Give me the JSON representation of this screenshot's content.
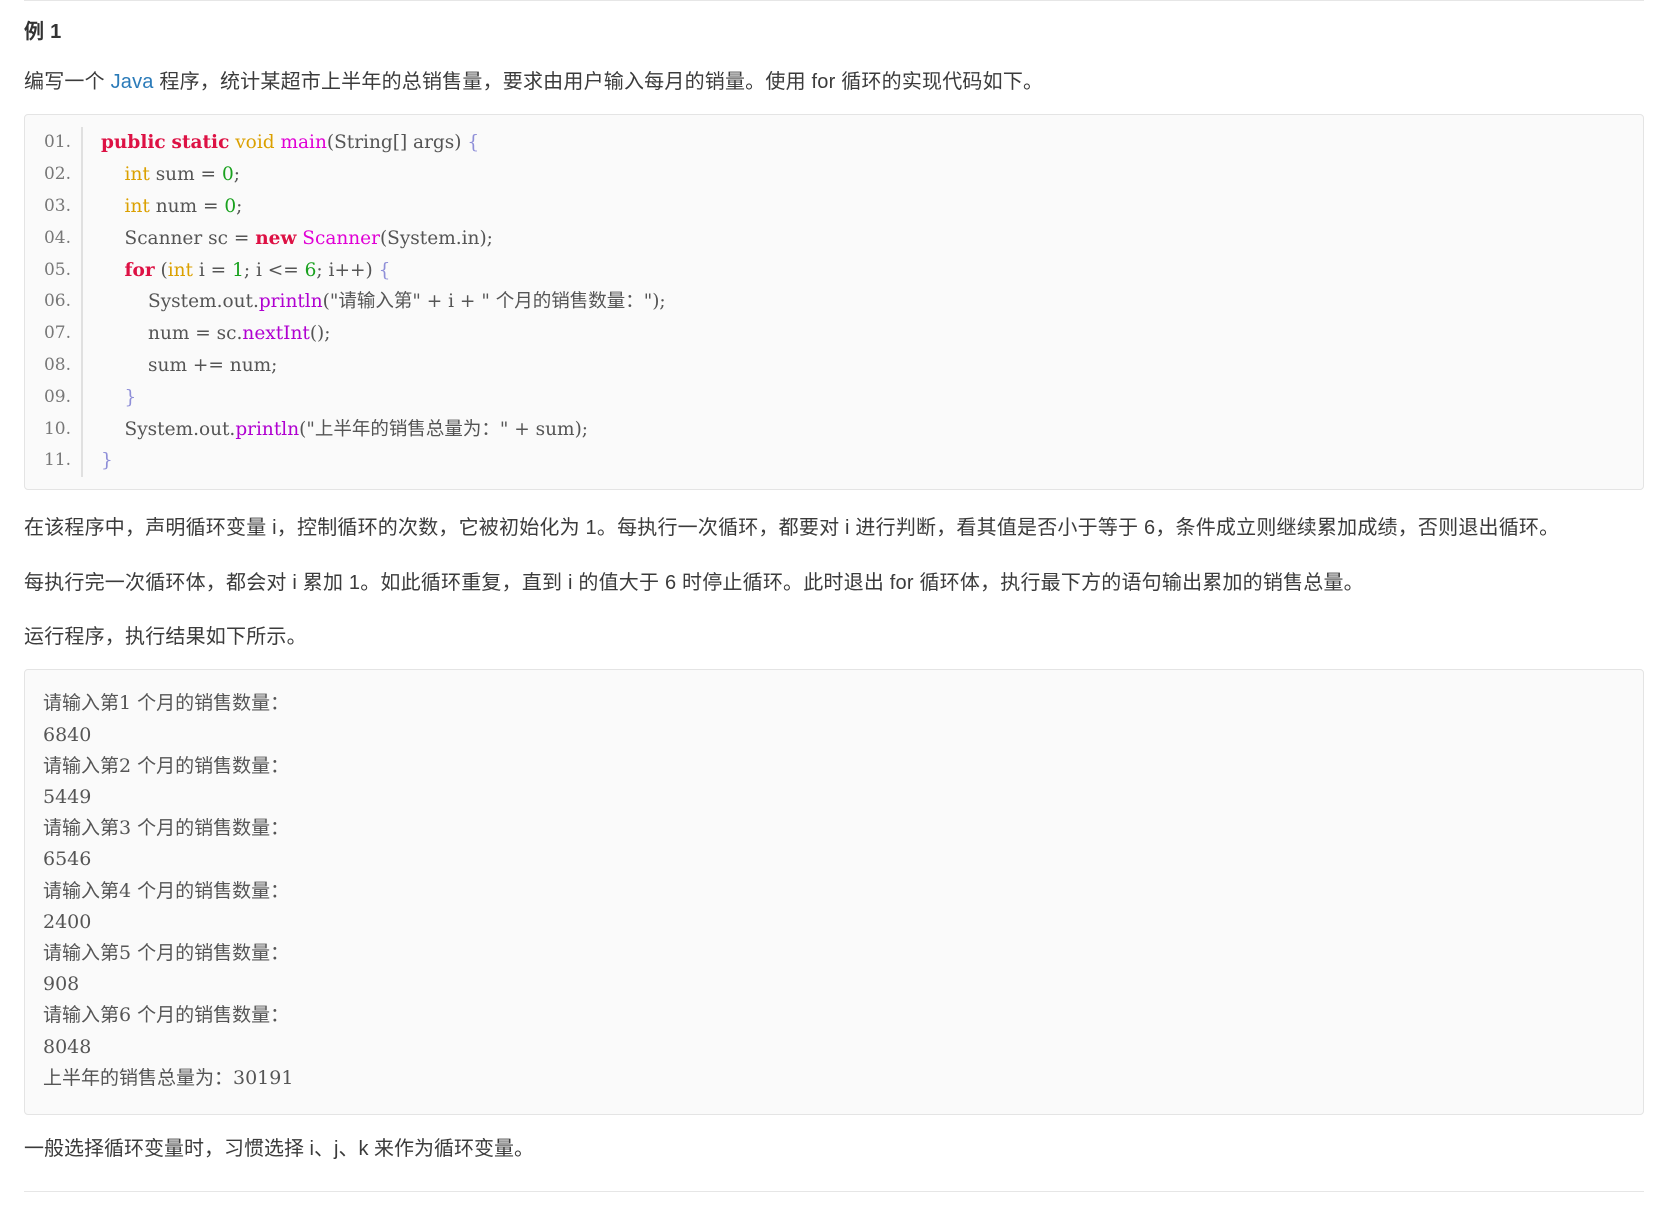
{
  "heading": "例 1",
  "intro": {
    "before_link": "编写一个 ",
    "link": "Java",
    "after_link": " 程序，统计某超市上半年的总销售量，要求由用户输入每月的销量。使用 for 循环的实现代码如下。"
  },
  "code_block": {
    "language": "java",
    "lines": [
      {
        "num": "01.",
        "tokens": [
          {
            "t": "public",
            "c": "k-red"
          },
          {
            "t": " ",
            "c": "k-plain"
          },
          {
            "t": "static",
            "c": "k-red"
          },
          {
            "t": " ",
            "c": "k-plain"
          },
          {
            "t": "void",
            "c": "k-orange"
          },
          {
            "t": " ",
            "c": "k-plain"
          },
          {
            "t": "main",
            "c": "k-pink"
          },
          {
            "t": "(String[] args)",
            "c": "k-plain"
          },
          {
            "t": " ",
            "c": "k-plain"
          },
          {
            "t": "{",
            "c": "k-brace"
          }
        ]
      },
      {
        "num": "02.",
        "tokens": [
          {
            "t": "    ",
            "c": "k-plain"
          },
          {
            "t": "int",
            "c": "k-orange"
          },
          {
            "t": " sum ",
            "c": "k-plain"
          },
          {
            "t": "=",
            "c": "k-plain"
          },
          {
            "t": " ",
            "c": "k-plain"
          },
          {
            "t": "0",
            "c": "k-green"
          },
          {
            "t": ";",
            "c": "k-plain"
          }
        ]
      },
      {
        "num": "03.",
        "tokens": [
          {
            "t": "    ",
            "c": "k-plain"
          },
          {
            "t": "int",
            "c": "k-orange"
          },
          {
            "t": " num ",
            "c": "k-plain"
          },
          {
            "t": "=",
            "c": "k-plain"
          },
          {
            "t": " ",
            "c": "k-plain"
          },
          {
            "t": "0",
            "c": "k-green"
          },
          {
            "t": ";",
            "c": "k-plain"
          }
        ]
      },
      {
        "num": "04.",
        "tokens": [
          {
            "t": "    Scanner sc ",
            "c": "k-plain"
          },
          {
            "t": "=",
            "c": "k-plain"
          },
          {
            "t": " ",
            "c": "k-plain"
          },
          {
            "t": "new",
            "c": "k-red"
          },
          {
            "t": " ",
            "c": "k-plain"
          },
          {
            "t": "Scanner",
            "c": "k-pink"
          },
          {
            "t": "(System.in);",
            "c": "k-plain"
          }
        ]
      },
      {
        "num": "05.",
        "tokens": [
          {
            "t": "    ",
            "c": "k-plain"
          },
          {
            "t": "for",
            "c": "k-red"
          },
          {
            "t": " (",
            "c": "k-plain"
          },
          {
            "t": "int",
            "c": "k-orange"
          },
          {
            "t": " i ",
            "c": "k-plain"
          },
          {
            "t": "=",
            "c": "k-plain"
          },
          {
            "t": " ",
            "c": "k-plain"
          },
          {
            "t": "1",
            "c": "k-green"
          },
          {
            "t": "; i <= ",
            "c": "k-plain"
          },
          {
            "t": "6",
            "c": "k-green"
          },
          {
            "t": "; i++) ",
            "c": "k-plain"
          },
          {
            "t": "{",
            "c": "k-brace"
          }
        ]
      },
      {
        "num": "06.",
        "tokens": [
          {
            "t": "        System.out.",
            "c": "k-plain"
          },
          {
            "t": "println",
            "c": "k-purple"
          },
          {
            "t": "(\"请输入第\" + i + \" 个月的销售数量：\");",
            "c": "k-plain"
          }
        ]
      },
      {
        "num": "07.",
        "tokens": [
          {
            "t": "        num = sc.",
            "c": "k-plain"
          },
          {
            "t": "nextInt",
            "c": "k-purple"
          },
          {
            "t": "();",
            "c": "k-plain"
          }
        ]
      },
      {
        "num": "08.",
        "tokens": [
          {
            "t": "        sum ",
            "c": "k-plain"
          },
          {
            "t": "+=",
            "c": "k-plain"
          },
          {
            "t": " num;",
            "c": "k-plain"
          }
        ]
      },
      {
        "num": "09.",
        "tokens": [
          {
            "t": "    ",
            "c": "k-plain"
          },
          {
            "t": "}",
            "c": "k-brace"
          }
        ]
      },
      {
        "num": "10.",
        "tokens": [
          {
            "t": "    System.out.",
            "c": "k-plain"
          },
          {
            "t": "println",
            "c": "k-purple"
          },
          {
            "t": "(\"上半年的销售总量为：\" + sum);",
            "c": "k-plain"
          }
        ]
      },
      {
        "num": "11.",
        "tokens": [
          {
            "t": "",
            "c": "k-plain"
          },
          {
            "t": "}",
            "c": "k-brace"
          }
        ]
      }
    ]
  },
  "explain_1": "在该程序中，声明循环变量 i，控制循环的次数，它被初始化为 1。每执行一次循环，都要对 i 进行判断，看其值是否小于等于 6，条件成立则继续累加成绩，否则退出循环。",
  "explain_2": "每执行完一次循环体，都会对 i 累加 1。如此循环重复，直到 i 的值大于 6 时停止循环。此时退出 for 循环体，执行最下方的语句输出累加的销售总量。",
  "run_caption": "运行程序，执行结果如下所示。",
  "output_block": {
    "lines": [
      "请输入第1 个月的销售数量：",
      "6840",
      "请输入第2 个月的销售数量：",
      "5449",
      "请输入第3 个月的销售数量：",
      "6546",
      "请输入第4 个月的销售数量：",
      "2400",
      "请输入第5 个月的销售数量：",
      "908",
      "请输入第6 个月的销售数量：",
      "8048",
      "上半年的销售总量为：30191"
    ]
  },
  "footer_note": "一般选择循环变量时，习惯选择 i、j、k 来作为循环变量。",
  "colors": {
    "link": "#2b7bb9",
    "keyword": "#dd1144",
    "type": "#dba000",
    "method_call": "#b000d0",
    "class_name": "#e000d5",
    "number": "#19a11e",
    "code_bg": "#fafafa",
    "border": "#e4e4e4",
    "text": "#3b3b3b"
  }
}
